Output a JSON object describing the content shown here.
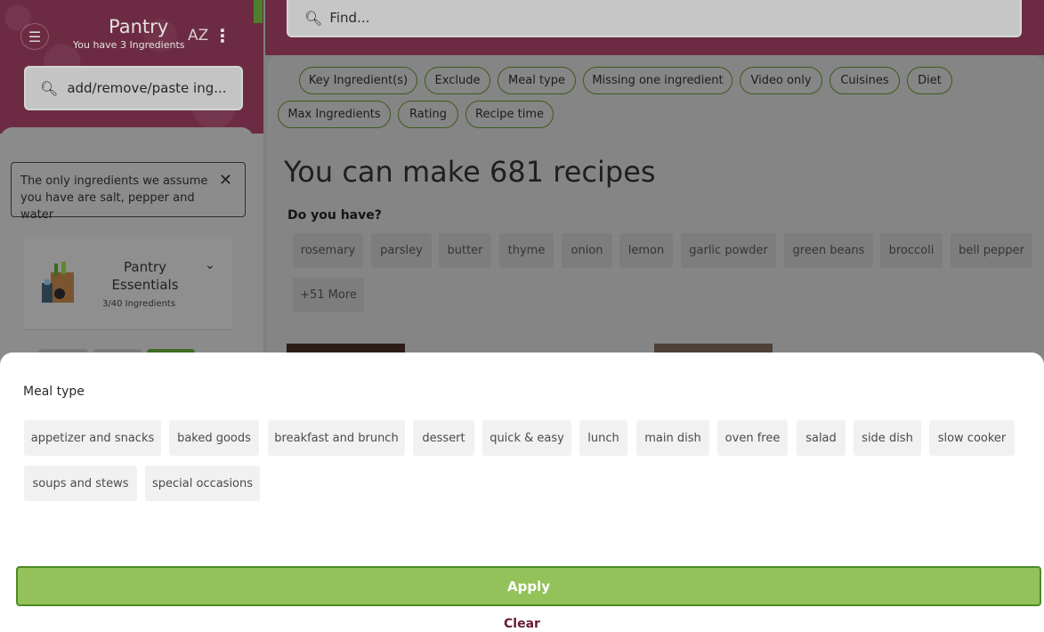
{
  "sidebar": {
    "title": "Pantry",
    "subtitle": "You have 3 Ingredients",
    "sort_label": "AZ",
    "search_placeholder": "add/remove/paste ing...",
    "notice": "The only ingredients we assume you have are salt, pepper and water",
    "category": {
      "title": "Pantry Essentials",
      "count": "3/40 Ingredients"
    }
  },
  "main": {
    "find_placeholder": "Find...",
    "filters": [
      "Key Ingredient(s)",
      "Exclude",
      "Meal type",
      "Missing one ingredient",
      "Video only",
      "Cuisines",
      "Diet",
      "Max Ingredients",
      "Rating",
      "Recipe time"
    ],
    "headline": "You can make 681 recipes",
    "do_you_have": "Do you have?",
    "suggestions": [
      "rosemary",
      "parsley",
      "butter",
      "thyme",
      "onion",
      "lemon",
      "garlic powder",
      "green beans",
      "broccoli",
      "bell pepper"
    ],
    "more_label": "+51 More"
  },
  "sheet": {
    "title": "Meal type",
    "options": [
      "appetizer and snacks",
      "baked goods",
      "breakfast and brunch",
      "dessert",
      "quick & easy",
      "lunch",
      "main dish",
      "oven free",
      "salad",
      "side dish",
      "slow cooker",
      "soups and stews",
      "special occasions"
    ],
    "apply_label": "Apply",
    "clear_label": "Clear"
  },
  "colors": {
    "brand": "#6d2b43",
    "apply_green": "#93c25a",
    "clear_text": "#6a1a33"
  }
}
